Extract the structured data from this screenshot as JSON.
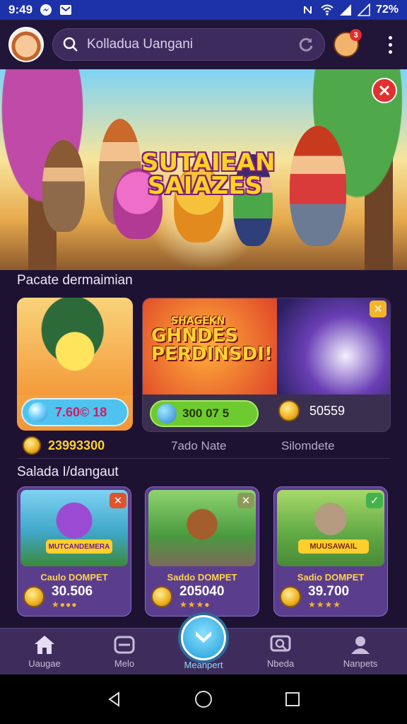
{
  "status_bar": {
    "time": "9:49",
    "battery": "72%"
  },
  "top_bar": {
    "search_text": "Kolladua Uangani",
    "notification_count": "3"
  },
  "hero": {
    "title_line1": "SUTAIEAN",
    "title_line2": "SAIAZES"
  },
  "section1": {
    "title": "Pacate dermaimian"
  },
  "card1": {
    "value": "7.60© 18"
  },
  "card2": {
    "headline_small": "SHAGEKN",
    "headline_line1": "GHNDES",
    "headline_line2": "PERDINSDI!",
    "pill_value": "300 07 5",
    "coin_value": "50559"
  },
  "row_coins": {
    "value": "23993300"
  },
  "row_labels": {
    "left": "7ado Nate",
    "right": "Silomdete"
  },
  "section2": {
    "title": "Salada I/dangaut"
  },
  "product_cards": [
    {
      "art_text": "MUTCANDEMERA",
      "label": "Caulo DOMPET",
      "value": "30.506",
      "stars": "★●●●"
    },
    {
      "art_text": "",
      "label": "Saddo DOMPET",
      "value": "205040",
      "stars": "★★★●"
    },
    {
      "art_text": "MUUSAWAIL",
      "label": "Sadio DOMPET",
      "value": "39.700",
      "stars": "★★★★"
    }
  ],
  "nav": {
    "items": [
      {
        "label": "Uaugae",
        "icon": "home-icon"
      },
      {
        "label": "Melo",
        "icon": "gamepad-icon"
      },
      {
        "label": "Meanpert",
        "icon": "cross-icon"
      },
      {
        "label": "Nbeda",
        "icon": "chat-icon"
      },
      {
        "label": "Nanpets",
        "icon": "user-icon"
      }
    ]
  },
  "colors": {
    "status_bar": "#1d31a8",
    "background": "#1e1233",
    "accent_gold": "#ffcf2e",
    "accent_blue": "#4fc3ef",
    "close_red": "#e23030"
  }
}
